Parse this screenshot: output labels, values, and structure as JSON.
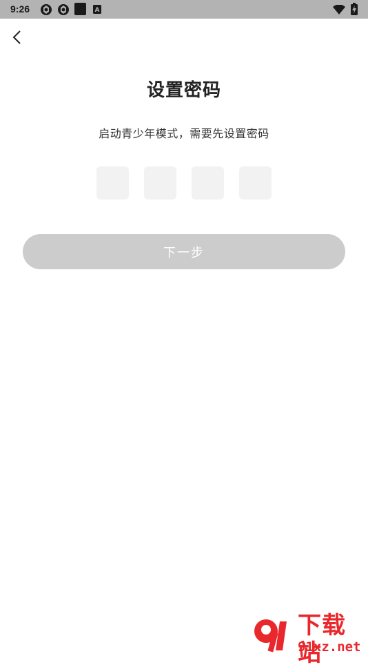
{
  "status_bar": {
    "time": "9:26",
    "notif_letter": "A"
  },
  "page": {
    "title": "设置密码",
    "subtitle": "启动青少年模式，需要先设置密码"
  },
  "pin": {
    "length": 4,
    "digits": [
      "",
      "",
      "",
      ""
    ]
  },
  "next_button": {
    "label": "下一步"
  },
  "watermark": {
    "text": "下载站",
    "url_text": "91xz.net",
    "logo_text": "9"
  },
  "colors": {
    "status_bg": "#b3b3b3",
    "button_disabled": "#cccccc",
    "pin_box": "#f2f2f2",
    "watermark_red": "#e8282d"
  }
}
